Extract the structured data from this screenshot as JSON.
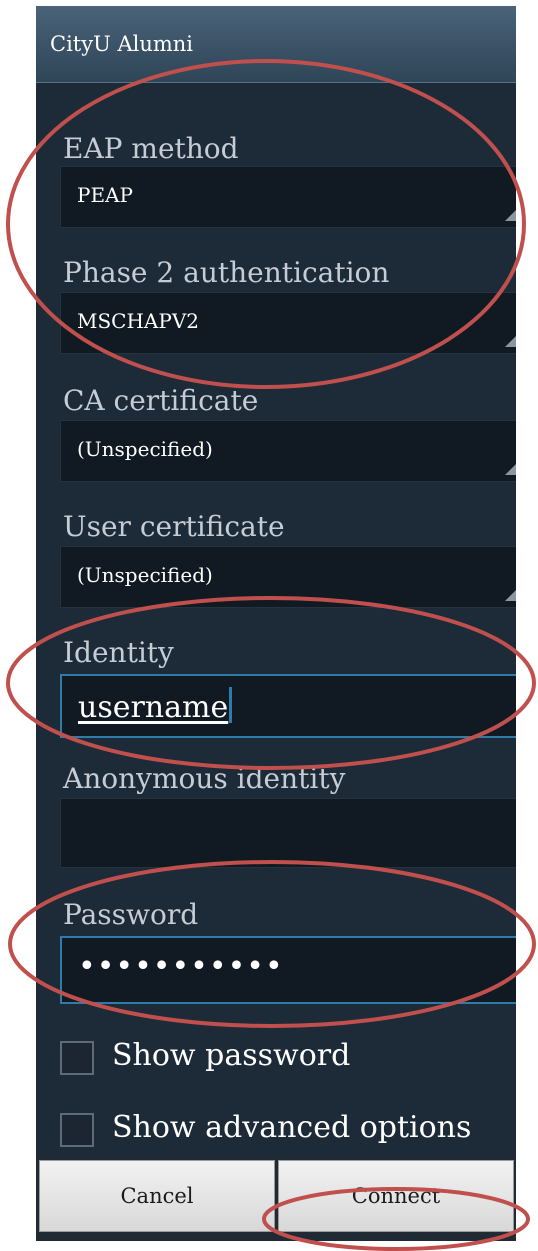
{
  "dialog": {
    "title": "CityU Alumni",
    "eap_method": {
      "label": "EAP method",
      "value": "PEAP"
    },
    "phase2": {
      "label": "Phase 2 authentication",
      "value": "MSCHAPV2"
    },
    "ca_certificate": {
      "label": "CA certificate",
      "value": "(Unspecified)"
    },
    "user_certificate": {
      "label": "User certificate",
      "value": "(Unspecified)"
    },
    "identity": {
      "label": "Identity",
      "value": "username"
    },
    "anonymous_identity": {
      "label": "Anonymous identity",
      "value": ""
    },
    "password": {
      "label": "Password",
      "value": "•••••••••••"
    },
    "show_password": {
      "label": "Show password",
      "checked": false
    },
    "show_advanced": {
      "label": "Show advanced options",
      "checked": false
    },
    "buttons": {
      "cancel": "Cancel",
      "connect": "Connect"
    }
  },
  "colors": {
    "annotation_ellipse": "#c0504d",
    "focus_accent": "#2f7cab",
    "panel_background": "#1d2a38"
  }
}
